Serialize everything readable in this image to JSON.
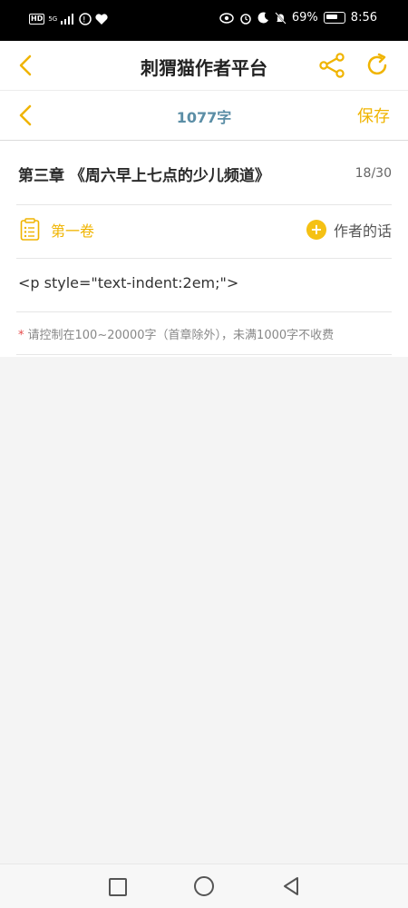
{
  "status": {
    "left": {
      "hd": "HD",
      "network": "5G"
    },
    "battery_percent": "69%",
    "time": "8:56"
  },
  "app": {
    "title": "刺猬猫作者平台"
  },
  "toolbar": {
    "word_count": "1077字",
    "save_label": "保存"
  },
  "chapter": {
    "title": "第三章 《周六早上七点的少儿频道》",
    "counter": "18/30"
  },
  "volume": {
    "label": "第一卷"
  },
  "author_words": {
    "label": "作者的话"
  },
  "editor": {
    "body": "<p style=\"text-indent:2em;\">"
  },
  "hint": {
    "star": "*",
    "text": "请控制在100~20000字（首章除外），未满1000字不收费"
  },
  "colors": {
    "accent": "#f0b400",
    "wordcount": "#5b8ea6",
    "hint_star": "#e64a4a"
  }
}
